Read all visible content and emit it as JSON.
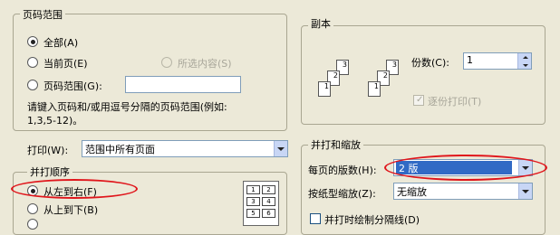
{
  "page_range": {
    "legend": "页码范围",
    "all": "全部(A)",
    "current": "当前页(E)",
    "selection": "所选内容(S)",
    "pages": "页码范围(G):",
    "pages_value": "",
    "hint": "请键入页码和/或用逗号分隔的页码范围(例如:",
    "hint_example": "1,3,5-12)。"
  },
  "copies": {
    "legend": "副本",
    "count_label": "份数(C):",
    "count_value": "1",
    "collate_label": "逐份打印(T)",
    "collate_checked": true,
    "pages_left": [
      "1",
      "2",
      "3"
    ],
    "pages_right": [
      "1",
      "2",
      "3"
    ]
  },
  "print_what": {
    "label": "打印(W):",
    "value": "范围中所有页面"
  },
  "print_order": {
    "legend": "并打顺序",
    "left_to_right": "从左到右(F)",
    "top_to_bottom": "从上到下(B)",
    "preview_cells": [
      "1",
      "2",
      "3",
      "4",
      "5",
      "6"
    ]
  },
  "zoom": {
    "legend": "并打和缩放",
    "pages_per_sheet_label": "每页的版数(H):",
    "pages_per_sheet_value": "2 版",
    "scale_label": "按纸型缩放(Z):",
    "scale_value": "无缩放",
    "draw_borders_label": "并打时绘制分隔线(D)"
  },
  "colors": {
    "dialog_bg": "#ece9d8",
    "highlight": "#316ac5",
    "annotation": "#e0151b"
  }
}
